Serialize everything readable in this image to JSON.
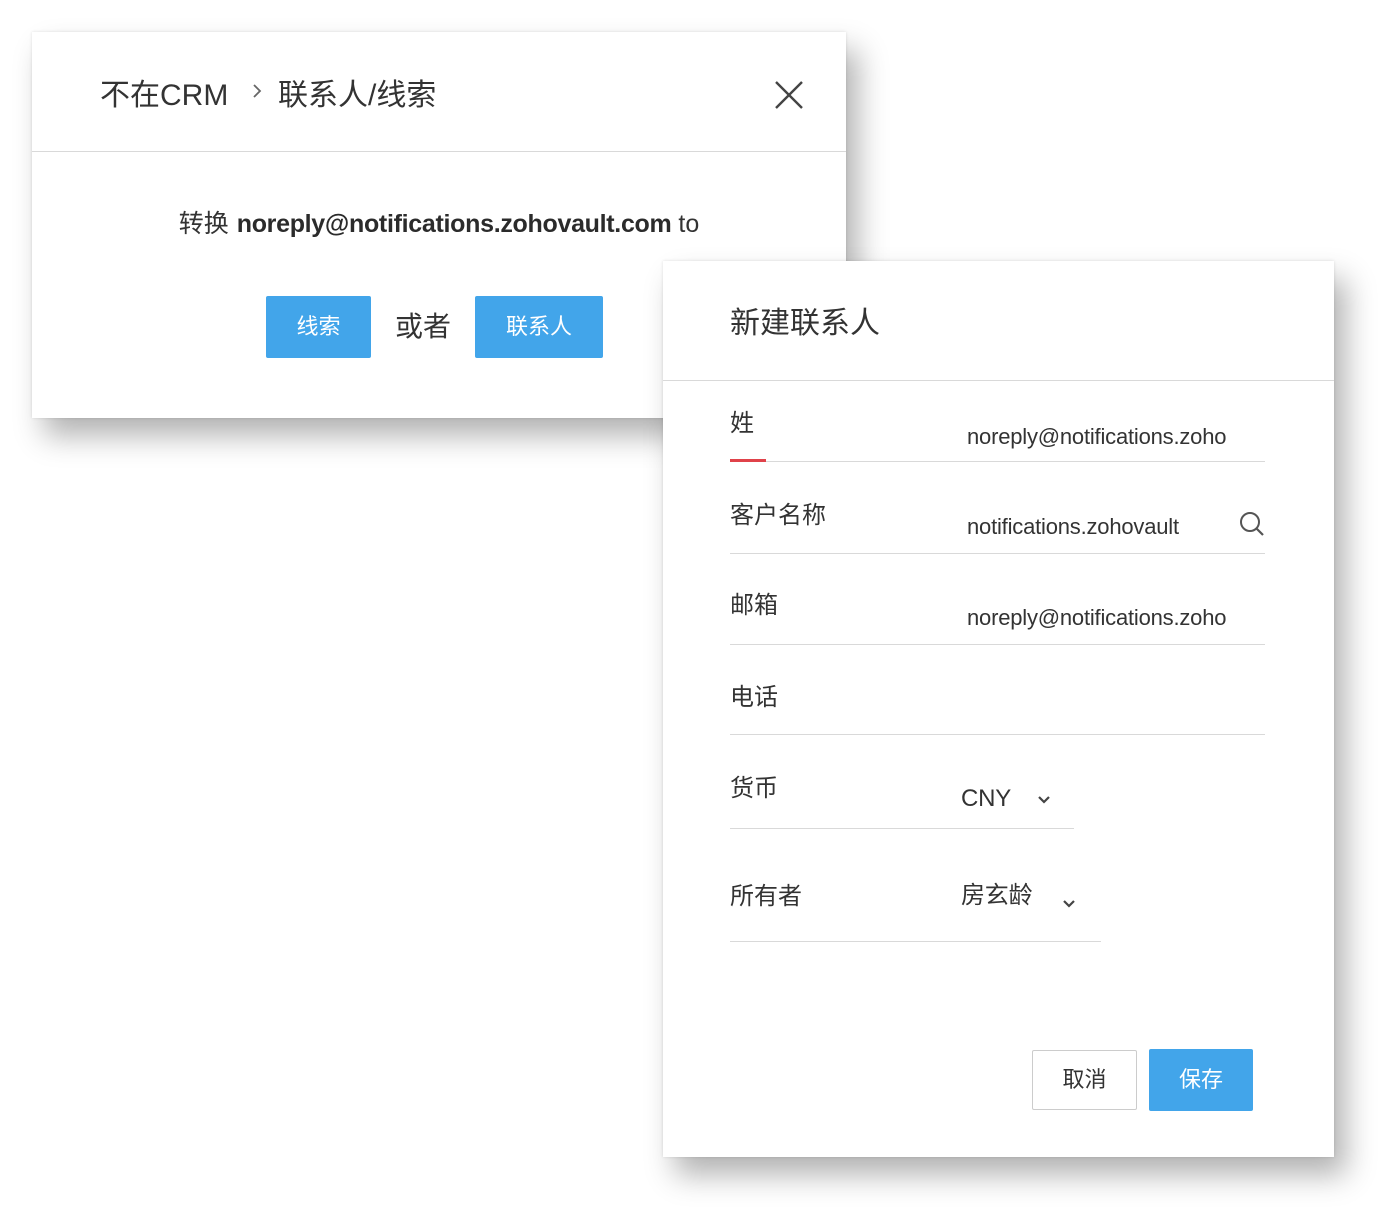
{
  "convert_dialog": {
    "breadcrumb_parent": "不在CRM",
    "breadcrumb_current": "联系人/线索",
    "convert_verb": "转换",
    "email": "noreply@notifications.zohovault.com",
    "convert_suffix": "to",
    "lead_label": "线索",
    "or_label": "或者",
    "contact_label": "联系人"
  },
  "new_contact": {
    "title": "新建联系人",
    "fields": {
      "last_name": {
        "label": "姓",
        "value": "noreply@notifications.zoho",
        "required": true
      },
      "account_name": {
        "label": "客户名称",
        "value": "notifications.zohovault"
      },
      "email": {
        "label": "邮箱",
        "value": "noreply@notifications.zoho"
      },
      "phone": {
        "label": "电话",
        "value": ""
      },
      "currency": {
        "label": "货币",
        "value": "CNY"
      },
      "owner": {
        "label": "所有者",
        "value": "房玄龄"
      }
    },
    "cancel_label": "取消",
    "save_label": "保存"
  },
  "colors": {
    "primary_blue": "#42a5ea",
    "required_red": "#e0424a",
    "divider": "#d9d9d9",
    "text": "#333333"
  },
  "icons": {
    "close": "close-icon",
    "breadcrumb_separator": "chevron-right-icon",
    "search": "search-icon",
    "dropdown": "chevron-down-icon"
  }
}
